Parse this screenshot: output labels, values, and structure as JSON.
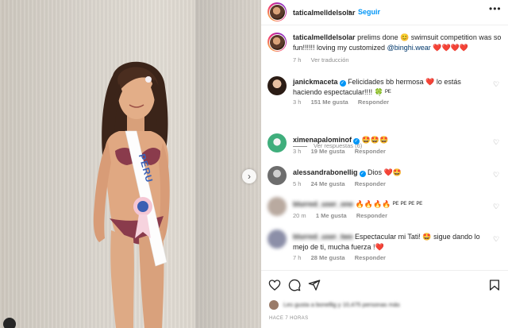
{
  "post": {
    "username": "taticalmelldelsolar",
    "follow_label": "Seguir",
    "more_label": "•••",
    "separator": "•"
  },
  "caption": {
    "username": "taticalmelldelsolar",
    "text": "prelims done 😊 swimsuit competition was so fun!!!!!! loving my customized",
    "mention": "@binghi.wear",
    "hearts": "❤️❤️❤️❤️",
    "time": "7 h",
    "translate_label": "Ver traducción"
  },
  "comments": [
    {
      "username": "janickmaceta",
      "text": "Felicidades bb hermosa ❤️ lo estás haciendo espectacular!!!! 🍀 ᴾᴱ",
      "time": "3 h",
      "likes": "151 Me gusta",
      "reply": "Responder",
      "view_replies": "Ver respuestas (6)"
    },
    {
      "username": "ximenapalominof",
      "text": "🤩🤩🤩",
      "time": "3 h",
      "likes": "19 Me gusta",
      "reply": "Responder"
    },
    {
      "username": "alessandrabonellig",
      "text": "Dios ❤️🤩",
      "time": "5 h",
      "likes": "24 Me gusta",
      "reply": "Responder"
    },
    {
      "username": "blurred_user_one",
      "text": "🔥🔥🔥🔥 ᴾᴱ ᴾᴱ ᴾᴱ ᴾᴱ",
      "time": "20 m",
      "likes": "1 Me gusta",
      "reply": "Responder"
    },
    {
      "username": "blurred_user_two",
      "text": "Espectacular mi Tati! 🤩 sigue dando lo mejo de ti, mucha fuerza !❤️",
      "time": "7 h",
      "likes": "28 Me gusta",
      "reply": "Responder"
    }
  ],
  "footer": {
    "likes_text": "Les gusta a bonellig y 10,475 personas más",
    "time_ago": "HACE 7 HORAS"
  },
  "photo": {
    "sash_text": "PERU"
  },
  "icons": {
    "like": "heart-icon",
    "comment": "comment-icon",
    "share": "paper-plane-icon",
    "save": "bookmark-icon",
    "next": "chevron-right-icon"
  },
  "colors": {
    "accent": "#0095f6",
    "link": "#00376b",
    "muted": "#8e8e8e",
    "text": "#262626",
    "heart": "#ed4956"
  }
}
